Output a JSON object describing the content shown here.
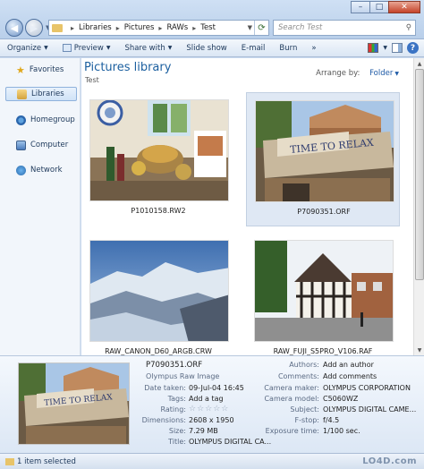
{
  "address": {
    "crumbs": [
      "Libraries",
      "Pictures",
      "RAWs",
      "Test"
    ]
  },
  "search": {
    "placeholder": "Search Test"
  },
  "toolbar": {
    "organize": "Organize",
    "preview": "Preview",
    "share_with": "Share with",
    "slide_show": "Slide show",
    "email": "E-mail",
    "burn": "Burn",
    "more": "»"
  },
  "sidebar": {
    "items": [
      {
        "label": "Favorites",
        "icon": "star-icon"
      },
      {
        "label": "Libraries",
        "icon": "library-icon"
      },
      {
        "label": "Homegroup",
        "icon": "homegroup-icon"
      },
      {
        "label": "Computer",
        "icon": "computer-icon"
      },
      {
        "label": "Network",
        "icon": "network-icon"
      }
    ]
  },
  "main": {
    "title": "Pictures library",
    "subtitle": "Test",
    "arrange_label": "Arrange by:",
    "arrange_value": "Folder",
    "files": [
      {
        "name": "P1010158.RW2"
      },
      {
        "name": "P7090351.ORF"
      },
      {
        "name": "RAW_CANON_D60_ARGB.CRW"
      },
      {
        "name": "RAW_FUJI_S5PRO_V106.RAF"
      }
    ]
  },
  "details": {
    "file_name": "P7090351.ORF",
    "file_type": "Olympus Raw Image",
    "left": [
      {
        "label": "Date taken:",
        "value": "09-Jul-04 16:45"
      },
      {
        "label": "Tags:",
        "value": "Add a tag"
      },
      {
        "label": "Rating:",
        "value": "☆☆☆☆☆"
      },
      {
        "label": "Dimensions:",
        "value": "2608 x 1950"
      },
      {
        "label": "Size:",
        "value": "7.29 MB"
      },
      {
        "label": "Title:",
        "value": "OLYMPUS DIGITAL CA..."
      }
    ],
    "right": [
      {
        "label": "Authors:",
        "value": "Add an author"
      },
      {
        "label": "Comments:",
        "value": "Add comments"
      },
      {
        "label": "Camera maker:",
        "value": "OLYMPUS CORPORATION"
      },
      {
        "label": "Camera model:",
        "value": "C5060WZ"
      },
      {
        "label": "Subject:",
        "value": "OLYMPUS DIGITAL CAME..."
      },
      {
        "label": "F-stop:",
        "value": "f/4.5"
      },
      {
        "label": "Exposure time:",
        "value": "1/100 sec."
      }
    ],
    "sign_text": "TIME TO RELAX"
  },
  "status": {
    "text": "1 item selected",
    "watermark": "LO4D.com"
  }
}
